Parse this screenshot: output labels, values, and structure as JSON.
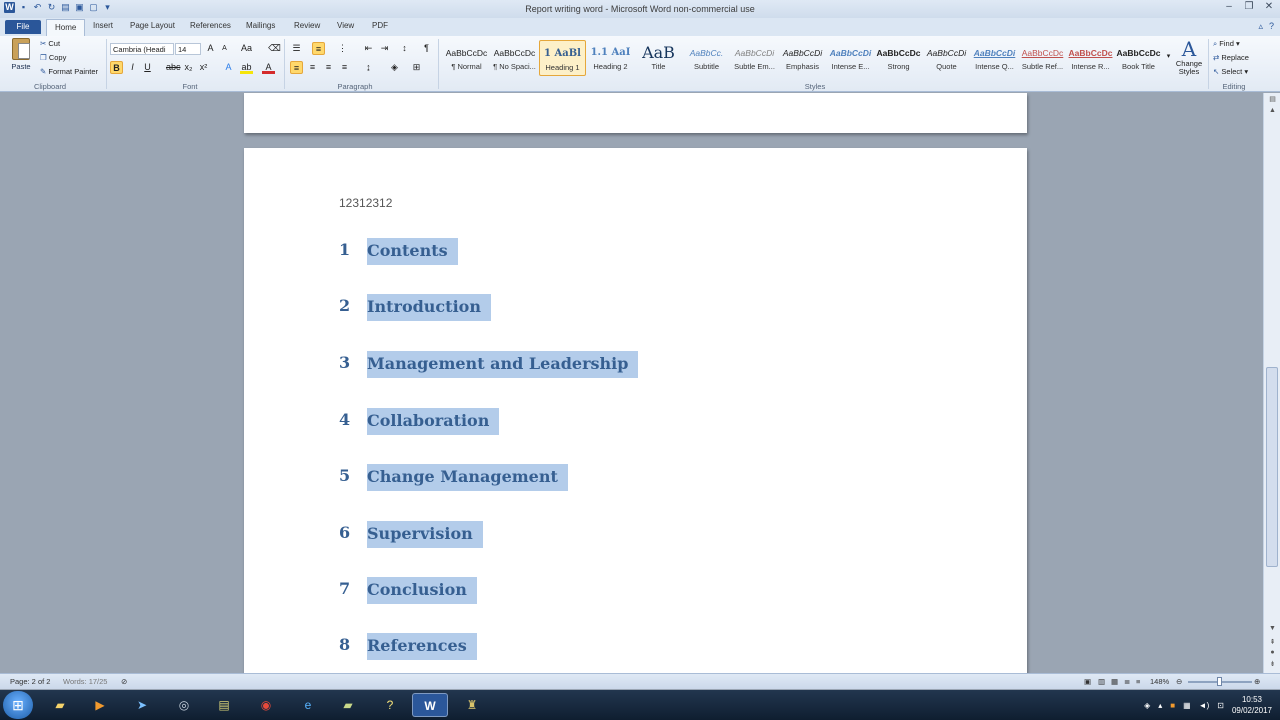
{
  "window": {
    "title": "Report writing word - Microsoft Word non-commercial use"
  },
  "tabs": [
    "File",
    "Home",
    "Insert",
    "Page Layout",
    "References",
    "Mailings",
    "Review",
    "View",
    "PDF"
  ],
  "ribbon": {
    "clipboard": {
      "paste": "Paste",
      "cut": "Cut",
      "copy": "Copy",
      "format_painter": "Format Painter",
      "label": "Clipboard"
    },
    "font": {
      "name": "Cambria (Headi",
      "size": "14",
      "label": "Font"
    },
    "paragraph": {
      "label": "Paragraph"
    },
    "styles_label": "Styles",
    "styles": [
      {
        "sample": "AaBbCcDc",
        "name": "¶ Normal"
      },
      {
        "sample": "AaBbCcDc",
        "name": "¶ No Spaci..."
      },
      {
        "sample": "1 AaBl",
        "name": "Heading 1"
      },
      {
        "sample": "1.1 AaI",
        "name": "Heading 2"
      },
      {
        "sample": "AaB",
        "name": "Title"
      },
      {
        "sample": "AaBbCc.",
        "name": "Subtitle"
      },
      {
        "sample": "AaBbCcDi",
        "name": "Subtle Em..."
      },
      {
        "sample": "AaBbCcDi",
        "name": "Emphasis"
      },
      {
        "sample": "AaBbCcDi",
        "name": "Intense E..."
      },
      {
        "sample": "AaBbCcDc",
        "name": "Strong"
      },
      {
        "sample": "AaBbCcDi",
        "name": "Quote"
      },
      {
        "sample": "AaBbCcDi",
        "name": "Intense Q..."
      },
      {
        "sample": "AaBbCcDc",
        "name": "Subtle Ref..."
      },
      {
        "sample": "AaBbCcDc",
        "name": "Intense R..."
      },
      {
        "sample": "AaBbCcDc",
        "name": "Book Title"
      }
    ],
    "change_styles": "Change Styles",
    "editing": {
      "find": "Find",
      "replace": "Replace",
      "select": "Select",
      "label": "Editing"
    }
  },
  "document": {
    "page_text": "12312312",
    "toc": [
      {
        "num": "1",
        "text": "Contents"
      },
      {
        "num": "2",
        "text": "Introduction"
      },
      {
        "num": "3",
        "text": "Management and Leadership"
      },
      {
        "num": "4",
        "text": "Collaboration"
      },
      {
        "num": "5",
        "text": "Change Management"
      },
      {
        "num": "6",
        "text": "Supervision"
      },
      {
        "num": "7",
        "text": "Conclusion"
      },
      {
        "num": "8",
        "text": "References"
      }
    ]
  },
  "status": {
    "page": "Page: 2 of 2",
    "words": "Words: 17/25",
    "zoom": "148%"
  },
  "taskbar": {
    "time": "10:53",
    "date": "09/02/2017"
  },
  "colors": {
    "heading": "#365f91",
    "selection": "#b3ccea",
    "word_blue": "#2b579a"
  }
}
